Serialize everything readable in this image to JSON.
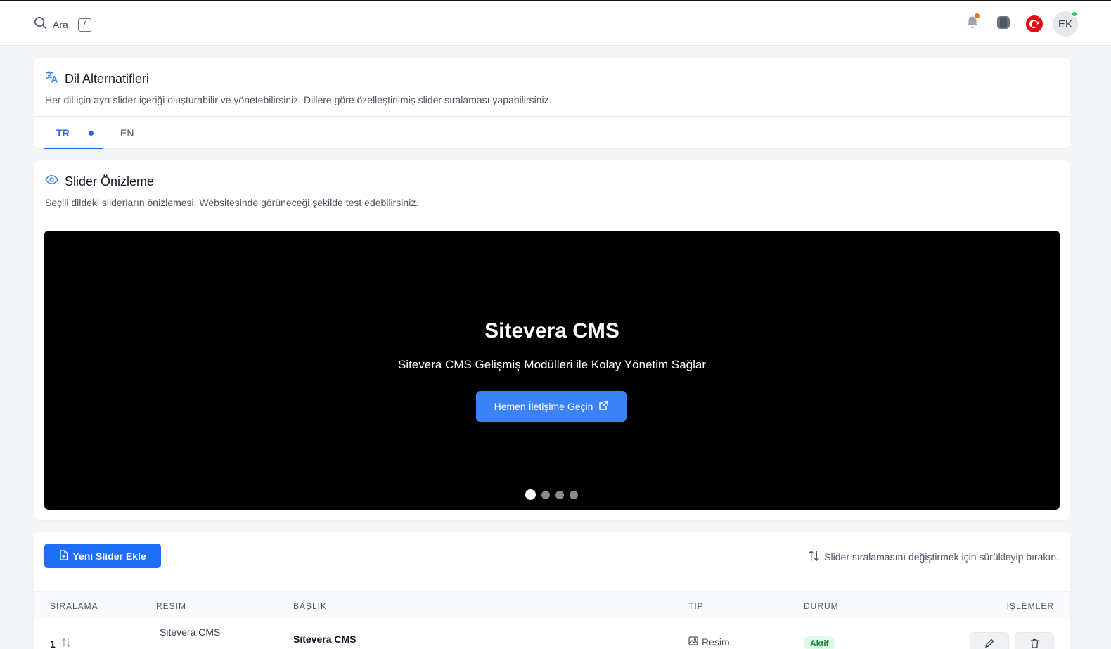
{
  "topbar": {
    "search_label": "Ara",
    "search_shortcut": "/",
    "avatar_initials": "EK",
    "language_flag": "tr"
  },
  "languages_card": {
    "title": "Dil Alternatifleri",
    "description": "Her dil için ayrı slider içeriği oluşturabilir ve yönetebilirsiniz. Dillere göre özelleştirilmiş slider sıralaması yapabilirsiniz.",
    "tabs": [
      {
        "label": "TR",
        "active": true
      },
      {
        "label": "EN",
        "active": false
      }
    ]
  },
  "preview_card": {
    "title": "Slider Önizleme",
    "description": "Seçili dildeki sliderların önizlemesi. Websitesinde görüneceği şekilde test edebilirsiniz.",
    "slide": {
      "title": "Sitevera CMS",
      "subtitle": "Sitevera CMS Gelişmiş Modülleri ile Kolay Yönetim Sağlar",
      "button_label": "Hemen İletişime Geçin"
    },
    "active_slide": 1
  },
  "list_card": {
    "add_button_label": "Yeni Slider Ekle",
    "hint": "Slider sıralamasını değiştirmek için sürükleyip bırakın.",
    "columns": {
      "order": "SIRALAMA",
      "image": "RESIM",
      "title": "BAŞLIK",
      "type": "TIP",
      "status": "DURUM",
      "actions": "İŞLEMLER"
    },
    "rows": [
      {
        "order": "1",
        "image_alt": "Sitevera CMS",
        "title": "Sitevera CMS",
        "type": "Resim",
        "status": "Aktif"
      }
    ]
  },
  "colors": {
    "primary": "#1d6ef5",
    "accent": "#3b82f6",
    "notification": "#f97316",
    "online": "#22c55e"
  }
}
